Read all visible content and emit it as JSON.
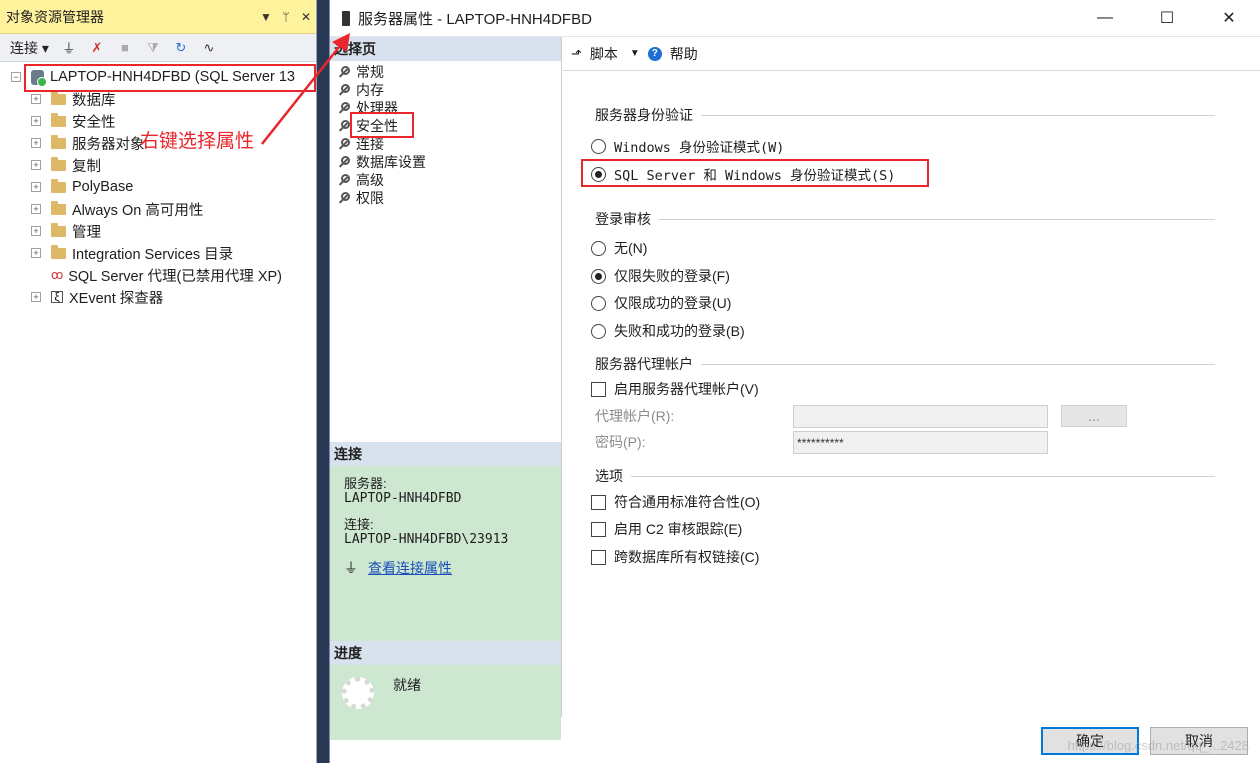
{
  "object_explorer": {
    "title": "对象资源管理器",
    "pin_glyph": "▾ ᛘ ✕",
    "toolbar": {
      "connect_label": "连接 ▾"
    },
    "server_node": "LAPTOP-HNH4DFBD (SQL Server 13",
    "tree_items": [
      "数据库",
      "安全性",
      "服务器对象",
      "复制",
      "PolyBase",
      "Always On 高可用性",
      "管理",
      "Integration Services 目录",
      "SQL Server 代理(已禁用代理 XP)",
      "XEvent 探查器"
    ]
  },
  "annotation": {
    "text": "右键选择属性",
    "color": "#e8262b"
  },
  "dialog": {
    "title": "服务器属性 - LAPTOP-HNH4DFBD",
    "select_page_header": "选择页",
    "pages": [
      "常规",
      "内存",
      "处理器",
      "安全性",
      "连接",
      "数据库设置",
      "高级",
      "权限"
    ],
    "connection": {
      "header": "连接",
      "server_label": "服务器:",
      "server_value": "LAPTOP-HNH4DFBD",
      "conn_label": "连接:",
      "conn_value": "LAPTOP-HNH4DFBD\\23913",
      "view_link": "查看连接属性"
    },
    "progress": {
      "header": "进度",
      "status": "就绪"
    },
    "toolbar": {
      "script": "脚本",
      "help": "帮助"
    },
    "server_auth": {
      "title": "服务器身份验证",
      "windows_mode": "Windows 身份验证模式(W)",
      "mixed_mode": "SQL Server 和 Windows 身份验证模式(S)"
    },
    "login_audit": {
      "title": "登录审核",
      "none": "无(N)",
      "failed_only": "仅限失败的登录(F)",
      "success_only": "仅限成功的登录(U)",
      "both": "失败和成功的登录(B)"
    },
    "proxy": {
      "title": "服务器代理帐户",
      "enable": "启用服务器代理帐户(V)",
      "account_label": "代理帐户(R):",
      "password_label": "密码(P):",
      "password_value": "**********",
      "browse": "..."
    },
    "options": {
      "title": "选项",
      "common_criteria": "符合通用标准符合性(O)",
      "c2_audit": "启用 C2 审核跟踪(E)",
      "cross_db": "跨数据库所有权链接(C)"
    },
    "buttons": {
      "ok": "确定",
      "cancel": "取消"
    },
    "watermark": "https://blog.csdn.net/qq_...2428"
  }
}
